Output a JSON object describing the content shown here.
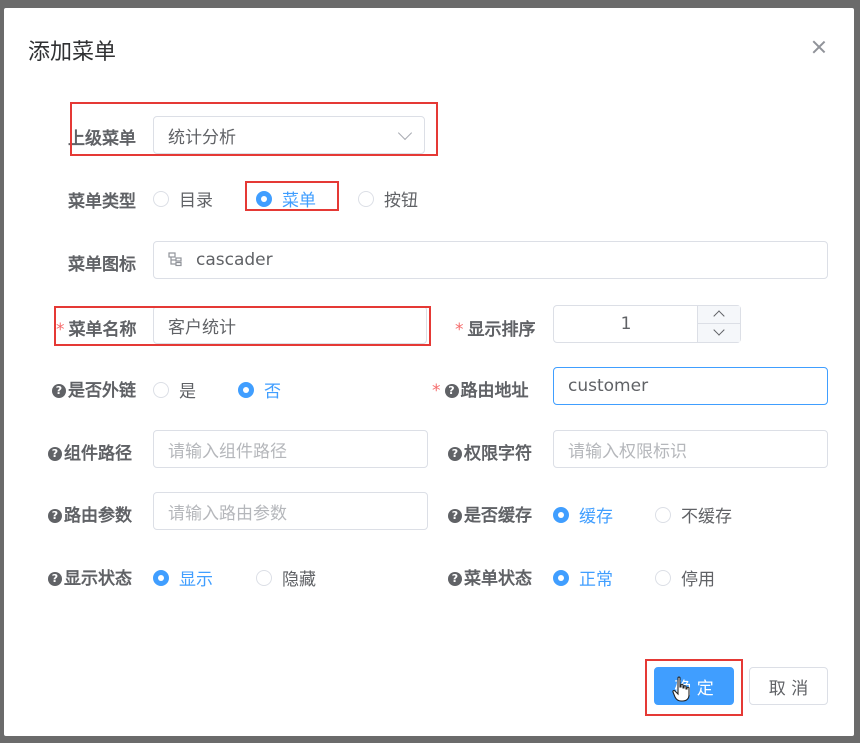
{
  "dialog": {
    "title": "添加菜单"
  },
  "form": {
    "parent_menu": {
      "label": "上级菜单",
      "value": "统计分析"
    },
    "menu_type": {
      "label": "菜单类型",
      "options": [
        "目录",
        "菜单",
        "按钮"
      ],
      "selected": "菜单"
    },
    "menu_icon": {
      "label": "菜单图标",
      "value": "cascader"
    },
    "menu_name": {
      "label": "菜单名称",
      "required_mark": "*",
      "value": "客户统计"
    },
    "display_order": {
      "label": "显示排序",
      "required_mark": "*",
      "value": "1"
    },
    "is_external": {
      "label": "是否外链",
      "options": [
        "是",
        "否"
      ],
      "selected": "否"
    },
    "route_path": {
      "label": "路由地址",
      "required_mark": "*",
      "value": "customer"
    },
    "component_path": {
      "label": "组件路径",
      "placeholder": "请输入组件路径"
    },
    "permission": {
      "label": "权限字符",
      "placeholder": "请输入权限标识"
    },
    "route_params": {
      "label": "路由参数",
      "placeholder": "请输入路由参数"
    },
    "is_cache": {
      "label": "是否缓存",
      "options": [
        "缓存",
        "不缓存"
      ],
      "selected": "缓存"
    },
    "visible": {
      "label": "显示状态",
      "options": [
        "显示",
        "隐藏"
      ],
      "selected": "显示"
    },
    "status": {
      "label": "菜单状态",
      "options": [
        "正常",
        "停用"
      ],
      "selected": "正常"
    }
  },
  "footer": {
    "confirm_label": "确 定",
    "cancel_label": "取 消"
  },
  "colors": {
    "primary": "#409eff",
    "required": "#f56c6c",
    "highlight": "#e53935",
    "overlay": "#6b6b6b"
  }
}
